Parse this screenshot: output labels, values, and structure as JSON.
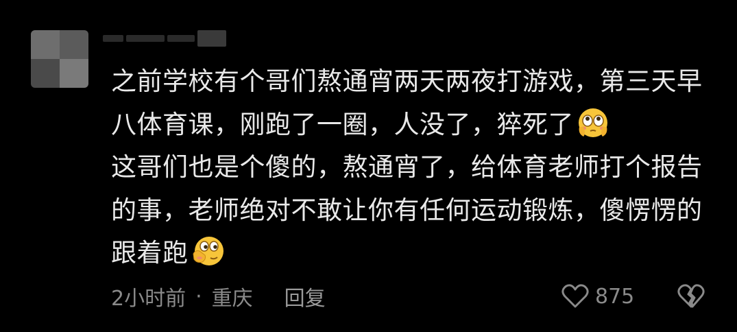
{
  "comment": {
    "avatar_icon": "blurred-avatar",
    "username_icon": "blurred-username",
    "paragraphs": [
      "之前学校有个哥们熬通宵两天两夜打游戏，第三天早八体育课，刚跑了一圈，人没了，猝死了",
      "这哥们也是个傻的，熬通宵了，给体育老师打个报告的事，老师绝对不敢让你有任何运动锻炼，傻愣愣的跟着跑"
    ],
    "emoji_1": "flushed-face-emoji",
    "emoji_2": "hand-over-mouth-emoji",
    "time": "2小时前",
    "separator": "·",
    "location": "重庆",
    "reply_label": "回复",
    "like_icon": "heart-icon",
    "like_count": "875",
    "dislike_icon": "broken-heart-icon"
  },
  "colors": {
    "background": "#000000",
    "text": "#e9e9e9",
    "meta_text": "#8a8a8a"
  }
}
